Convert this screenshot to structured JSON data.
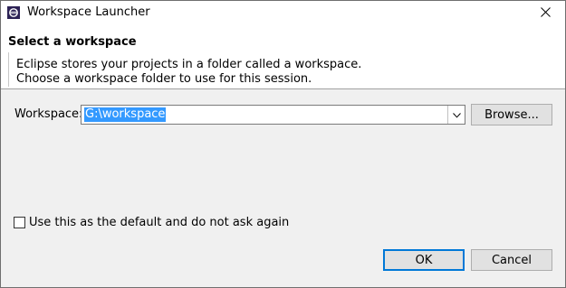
{
  "window": {
    "title": "Workspace Launcher"
  },
  "banner": {
    "heading": "Select a workspace",
    "message_line1": "Eclipse stores your projects in a folder called a workspace.",
    "message_line2": "Choose a workspace folder to use for this session."
  },
  "workspace": {
    "label": "Workspace:",
    "value": "G:\\workspace",
    "browse_label": "Browse..."
  },
  "default_option": {
    "label": "Use this as the default and do not ask again",
    "checked": false
  },
  "buttons": {
    "ok_label": "OK",
    "cancel_label": "Cancel"
  },
  "icons": {
    "app": "eclipse-icon",
    "close": "close-icon",
    "dropdown": "chevron-down-icon"
  },
  "colors": {
    "selection": "#3399ff",
    "default_button_border": "#0078d7"
  }
}
